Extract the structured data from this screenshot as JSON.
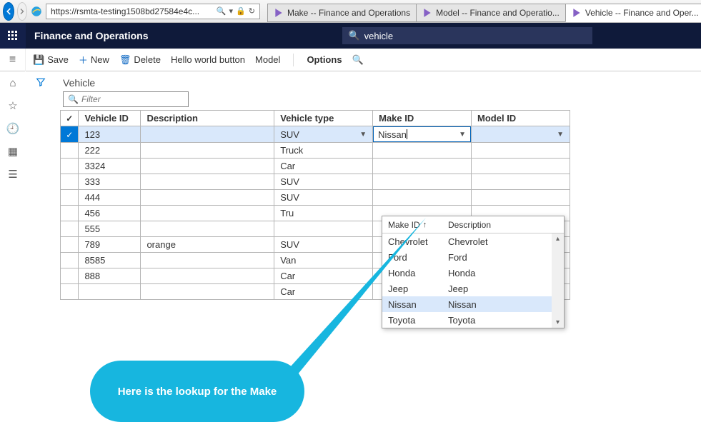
{
  "browser": {
    "url": "https://rsmta-testing1508bd27584e4c...",
    "search_icon": "🔍",
    "refresh_icon": "⟳",
    "lock_icon": "🔒",
    "tabs": [
      {
        "label": "Make -- Finance and Operations"
      },
      {
        "label": "Model -- Finance and Operatio..."
      },
      {
        "label": "Vehicle -- Finance and Oper..."
      }
    ]
  },
  "app": {
    "title": "Finance and Operations",
    "search_icon": "🔍",
    "search_value": "vehicle"
  },
  "toolbar": {
    "save": "Save",
    "new": "New",
    "delete": "Delete",
    "hello": "Hello world button",
    "model": "Model",
    "options": "Options"
  },
  "page": {
    "title": "Vehicle",
    "filter_placeholder": "Filter"
  },
  "grid": {
    "headers": {
      "check": "✓",
      "vid": "Vehicle ID",
      "desc": "Description",
      "type": "Vehicle type",
      "make": "Make ID",
      "model": "Model ID"
    },
    "rows": [
      {
        "vid": "123",
        "desc": "",
        "type": "SUV",
        "make": "Nissan",
        "model": "",
        "selected": true,
        "editing": true
      },
      {
        "vid": "222",
        "desc": "",
        "type": "Truck",
        "make": "",
        "model": ""
      },
      {
        "vid": "3324",
        "desc": "",
        "type": "Car",
        "make": "",
        "model": ""
      },
      {
        "vid": "333",
        "desc": "",
        "type": "SUV",
        "make": "",
        "model": ""
      },
      {
        "vid": "444",
        "desc": "",
        "type": "SUV",
        "make": "",
        "model": ""
      },
      {
        "vid": "456",
        "desc": "",
        "type": "Tru",
        "make": "",
        "model": ""
      },
      {
        "vid": "555",
        "desc": "",
        "type": "",
        "make": "",
        "model": ""
      },
      {
        "vid": "789",
        "desc": "orange",
        "type": "SUV",
        "make": "",
        "model": ""
      },
      {
        "vid": "8585",
        "desc": "",
        "type": "Van",
        "make": "",
        "model": ""
      },
      {
        "vid": "888",
        "desc": "",
        "type": "Car",
        "make": "",
        "model": ""
      },
      {
        "vid": "",
        "desc": "",
        "type": "Car",
        "make": "",
        "model": ""
      }
    ]
  },
  "lookup": {
    "col1": "Make ID",
    "col2": "Description",
    "rows": [
      {
        "id": "Chevrolet",
        "desc": "Chevrolet"
      },
      {
        "id": "Ford",
        "desc": "Ford"
      },
      {
        "id": "Honda",
        "desc": "Honda"
      },
      {
        "id": "Jeep",
        "desc": "Jeep"
      },
      {
        "id": "Nissan",
        "desc": "Nissan",
        "sel": true
      },
      {
        "id": "Toyota",
        "desc": "Toyota"
      }
    ]
  },
  "callout": {
    "text": "Here is the lookup for the Make"
  }
}
